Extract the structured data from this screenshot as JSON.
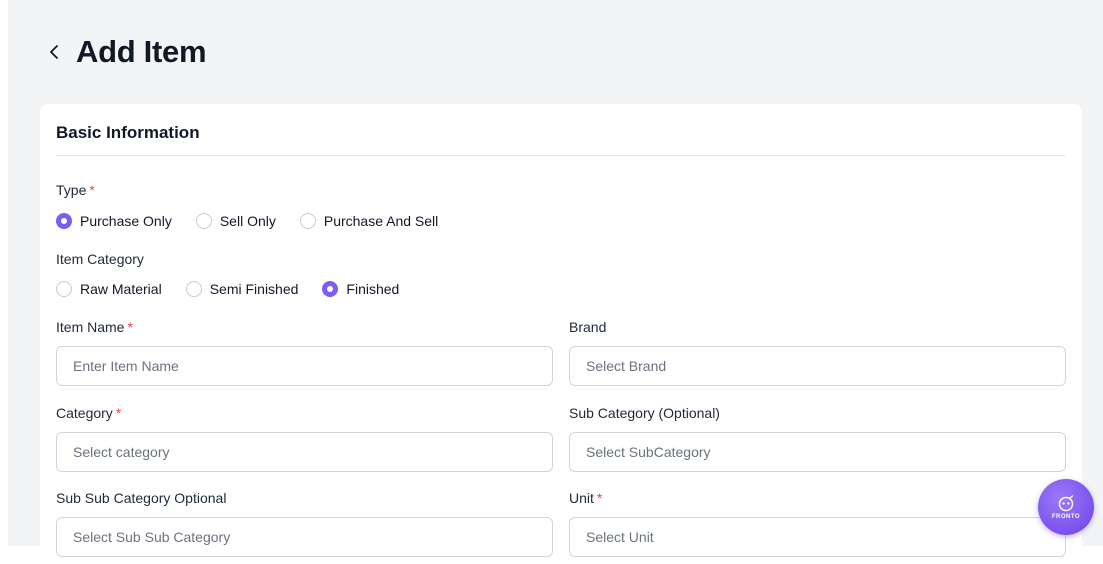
{
  "header": {
    "title": "Add Item"
  },
  "basic_info": {
    "title": "Basic Information"
  },
  "type": {
    "label": "Type",
    "required_mark": "*",
    "options": [
      {
        "label": "Purchase Only",
        "checked": true
      },
      {
        "label": "Sell Only",
        "checked": false
      },
      {
        "label": "Purchase And Sell",
        "checked": false
      }
    ]
  },
  "item_category": {
    "label": "Item Category",
    "options": [
      {
        "label": "Raw Material",
        "checked": false
      },
      {
        "label": "Semi Finished",
        "checked": false
      },
      {
        "label": "Finished",
        "checked": true
      }
    ]
  },
  "fields": {
    "item_name": {
      "label": "Item Name",
      "required_mark": "*",
      "placeholder": "Enter Item Name",
      "value": ""
    },
    "brand": {
      "label": "Brand",
      "placeholder": "Select Brand",
      "value": ""
    },
    "category": {
      "label": "Category",
      "required_mark": "*",
      "placeholder": "Select category",
      "value": ""
    },
    "sub_category": {
      "label": "Sub Category (Optional)",
      "placeholder": "Select SubCategory",
      "value": ""
    },
    "sub_sub_category": {
      "label": "Sub Sub Category Optional",
      "placeholder": "Select Sub Sub Category",
      "value": ""
    },
    "unit": {
      "label": "Unit",
      "required_mark": "*",
      "placeholder": "Select Unit",
      "value": ""
    }
  },
  "fab": {
    "text": "FRONTO"
  },
  "colors": {
    "accent": "#7c5cf2",
    "required": "#ef4444",
    "background": "#f3f4f6"
  },
  "icons": {
    "back": "chevron-left-icon",
    "assistant": "assistant-bot-icon"
  }
}
